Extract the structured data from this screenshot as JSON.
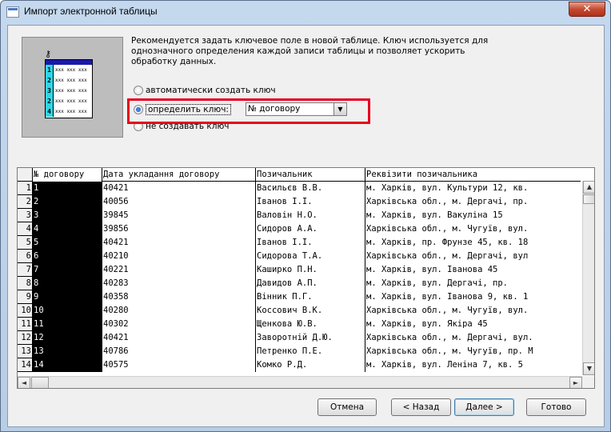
{
  "window": {
    "title": "Импорт электронной таблицы",
    "close_label": "✕"
  },
  "illustration": {
    "key_glyph": "⚷",
    "rows": [
      {
        "num": "1",
        "vals": "xxx xxx xxx"
      },
      {
        "num": "2",
        "vals": "xxx xxx xxx"
      },
      {
        "num": "3",
        "vals": "xxx xxx xxx"
      },
      {
        "num": "2",
        "vals": "xxx xxx xxx"
      },
      {
        "num": "4",
        "vals": "xxx xxx xxx"
      }
    ]
  },
  "description": "Рекомендуется задать ключевое поле в новой таблице.  Ключ используется для однозначного определения каждой записи таблицы и позволяет ускорить обработку данных.",
  "options": {
    "auto_key": "автоматически создать ключ",
    "define_key": "определить ключ:",
    "no_key": "не создавать ключ",
    "selected": "define_key"
  },
  "key_field": {
    "value": "№ договору",
    "dropdown_glyph": "▼"
  },
  "grid": {
    "columns": [
      "№ договору",
      "Дата укладання договору",
      "Позичальник",
      "Реквізити позичальника"
    ],
    "rows": [
      {
        "n": "1",
        "c1": "1",
        "c2": "40421",
        "c3": "Васильєв В.В.",
        "c4": "м. Харків, вул. Культури 12, кв."
      },
      {
        "n": "2",
        "c1": "2",
        "c2": "40056",
        "c3": "Іванов І.І.",
        "c4": "Харківська обл., м. Дергачі, пр."
      },
      {
        "n": "3",
        "c1": "3",
        "c2": "39845",
        "c3": "Валовін Н.О.",
        "c4": "м. Харків, вул. Вакуліна 15"
      },
      {
        "n": "4",
        "c1": "4",
        "c2": "39856",
        "c3": "Сидоров А.А.",
        "c4": "Харківська обл., м. Чугуїв, вул."
      },
      {
        "n": "5",
        "c1": "5",
        "c2": "40421",
        "c3": "Іванов І.І.",
        "c4": "м. Харків, пр. Фрунзе 45, кв. 18"
      },
      {
        "n": "6",
        "c1": "6",
        "c2": "40210",
        "c3": "Сидорова Т.А.",
        "c4": "Харківська обл., м. Дергачі, вул"
      },
      {
        "n": "7",
        "c1": "7",
        "c2": "40221",
        "c3": "Каширко П.Н.",
        "c4": "м. Харків, вул. Іванова 45"
      },
      {
        "n": "8",
        "c1": "8",
        "c2": "40283",
        "c3": "Давидов А.П.",
        "c4": "м. Харків, вул. Дергачі, пр."
      },
      {
        "n": "9",
        "c1": "9",
        "c2": "40358",
        "c3": "Вінник П.Г.",
        "c4": "м. Харків, вул. Іванова 9, кв. 1"
      },
      {
        "n": "10",
        "c1": "10",
        "c2": "40280",
        "c3": "Коссович В.К.",
        "c4": "Харківська обл., м. Чугуїв, вул."
      },
      {
        "n": "11",
        "c1": "11",
        "c2": "40302",
        "c3": "Щенкова Ю.В.",
        "c4": "м. Харків, вул. Якіра 45"
      },
      {
        "n": "12",
        "c1": "12",
        "c2": "40421",
        "c3": "Заворотній  Д.Ю.",
        "c4": "Харківська обл., м. Дергачі, вул."
      },
      {
        "n": "13",
        "c1": "13",
        "c2": "40786",
        "c3": "Петренко П.Е.",
        "c4": "Харківська обл., м. Чугуїв, пр. М"
      },
      {
        "n": "14",
        "c1": "14",
        "c2": "40575",
        "c3": "Комко Р.Д.",
        "c4": "м. Харків, вул. Леніна 7, кв. 5"
      }
    ]
  },
  "scroll": {
    "up": "▲",
    "down": "▼",
    "left": "◄",
    "right": "►"
  },
  "buttons": {
    "cancel": "Отмена",
    "back": "< Назад",
    "next": "Далее >",
    "finish": "Готово"
  }
}
